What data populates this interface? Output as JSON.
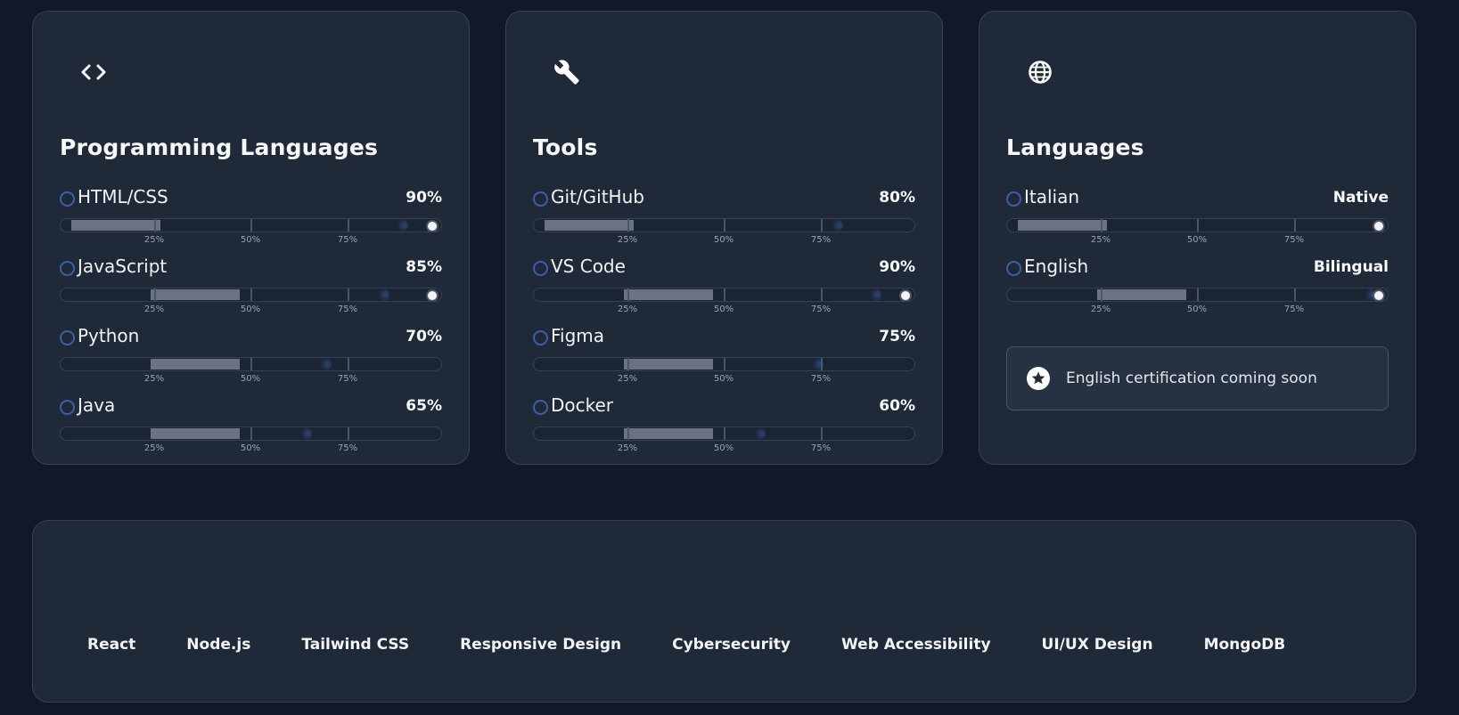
{
  "cards": [
    {
      "icon": "code-icon",
      "title": "Programming Languages",
      "skills": [
        {
          "name": "HTML/CSS",
          "value": "90%",
          "level": 90
        },
        {
          "name": "JavaScript",
          "value": "85%",
          "level": 85
        },
        {
          "name": "Python",
          "value": "70%",
          "level": 70
        },
        {
          "name": "Java",
          "value": "65%",
          "level": 65
        }
      ]
    },
    {
      "icon": "wrench-icon",
      "title": "Tools",
      "skills": [
        {
          "name": "Git/GitHub",
          "value": "80%",
          "level": 80
        },
        {
          "name": "VS Code",
          "value": "90%",
          "level": 90
        },
        {
          "name": "Figma",
          "value": "75%",
          "level": 75
        },
        {
          "name": "Docker",
          "value": "60%",
          "level": 60
        }
      ]
    },
    {
      "icon": "globe-icon",
      "title": "Languages",
      "skills": [
        {
          "name": "Italian",
          "value": "Native",
          "level": 100
        },
        {
          "name": "English",
          "value": "Bilingual",
          "level": 100
        }
      ],
      "note": {
        "icon": "star-badge-icon",
        "text": "English certification coming soon"
      }
    }
  ],
  "tick_labels": [
    "25%",
    "50%",
    "75%"
  ],
  "tags": [
    "React",
    "Node.js",
    "Tailwind CSS",
    "Responsive Design",
    "Cybersecurity",
    "Web Accessibility",
    "UI/UX Design",
    "MongoDB"
  ],
  "colors": {
    "background": "#111827",
    "card": "#1f2937",
    "accent": "#3b5fa8",
    "fill": "#6b7280"
  }
}
